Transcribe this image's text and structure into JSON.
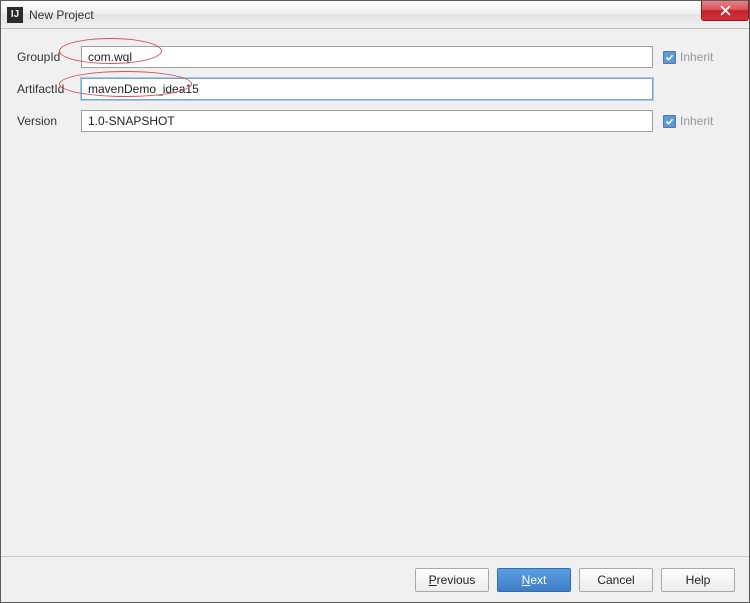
{
  "window": {
    "title": "New Project"
  },
  "form": {
    "groupId": {
      "label": "GroupId",
      "value": "com.wql",
      "inherit_label": "Inherit",
      "inherit_checked": true
    },
    "artifactId": {
      "label": "ArtifactId",
      "value": "mavenDemo_idea15"
    },
    "version": {
      "label": "Version",
      "value": "1.0-SNAPSHOT",
      "inherit_label": "Inherit",
      "inherit_checked": true
    }
  },
  "buttons": {
    "previous": "Previous",
    "previous_mn": "P",
    "previous_rest": "revious",
    "next": "Next",
    "next_mn": "N",
    "next_rest": "ext",
    "cancel": "Cancel",
    "help": "Help"
  }
}
